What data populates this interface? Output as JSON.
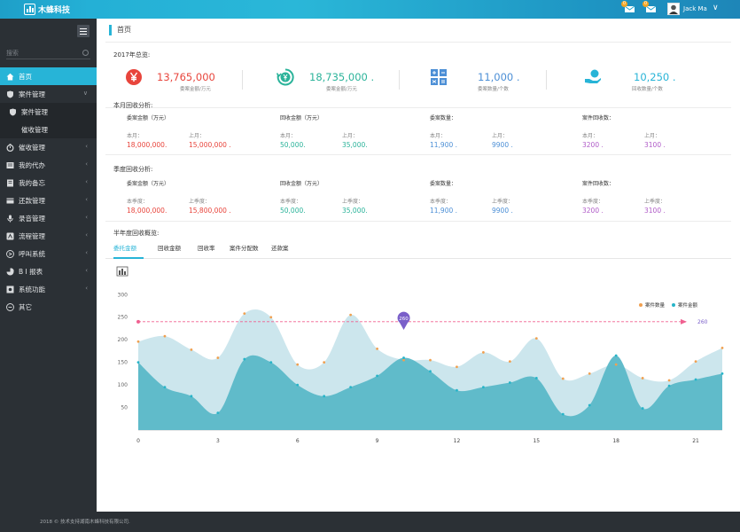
{
  "app": {
    "logo_text": "木蜂科技",
    "page_title": "首页"
  },
  "topbar": {
    "notifications": [
      {
        "icon": "inbox-icon",
        "count": "0"
      },
      {
        "icon": "inbox-download-icon",
        "count": "0"
      }
    ],
    "user_name": "Jack Ma",
    "user_caret": "∨"
  },
  "sidebar": {
    "search_placeholder": "搜索",
    "items": [
      {
        "label": "首页",
        "icon": "home-icon",
        "active": true,
        "sub": false,
        "arrow": ""
      },
      {
        "label": "案件管理",
        "icon": "shield-icon",
        "active": false,
        "sub": false,
        "arrow": "∨"
      },
      {
        "label": "案件管理",
        "icon": "shield-icon",
        "active": false,
        "sub": true,
        "arrow": ""
      },
      {
        "label": "催收管理",
        "icon": "",
        "active": false,
        "sub": true,
        "arrow": ""
      },
      {
        "label": "催收管理",
        "icon": "stopwatch-icon",
        "active": false,
        "sub": false,
        "arrow": "‹"
      },
      {
        "label": "我的代办",
        "icon": "list-icon",
        "active": false,
        "sub": false,
        "arrow": "‹"
      },
      {
        "label": "我的备忘",
        "icon": "book-icon",
        "active": false,
        "sub": false,
        "arrow": "‹"
      },
      {
        "label": "还款管理",
        "icon": "card-icon",
        "active": false,
        "sub": false,
        "arrow": "‹"
      },
      {
        "label": "录音管理",
        "icon": "microphone-icon",
        "active": false,
        "sub": false,
        "arrow": "‹"
      },
      {
        "label": "流程管理",
        "icon": "flow-icon",
        "active": false,
        "sub": false,
        "arrow": "‹"
      },
      {
        "label": "呼叫系统",
        "icon": "phone-icon",
        "active": false,
        "sub": false,
        "arrow": "‹"
      },
      {
        "label": "B I 报表",
        "icon": "pie-icon",
        "active": false,
        "sub": false,
        "arrow": "‹"
      },
      {
        "label": "系统功能",
        "icon": "gear-icon",
        "active": false,
        "sub": false,
        "arrow": "‹"
      },
      {
        "label": "其它",
        "icon": "ellipsis-icon",
        "active": false,
        "sub": false,
        "arrow": ""
      }
    ]
  },
  "overview": {
    "title": "2017年总览:",
    "stats": [
      {
        "value": "13,765,000",
        "caption": "委案金额/万元",
        "icon": "yen-icon",
        "color": "#e8453c"
      },
      {
        "value": "18,735,000 .",
        "caption": "委案金额/万元",
        "icon": "recycle-yen-icon",
        "color": "#2bb39a"
      },
      {
        "value": "11,000 .",
        "caption": "委案数量/个数",
        "icon": "calculator-icon",
        "color": "#4c8fd6"
      },
      {
        "value": "10,250 .",
        "caption": "回收数量/个数",
        "icon": "hand-money-icon",
        "color": "#27b4d7"
      }
    ]
  },
  "monthly": {
    "title": "本月回收分析:",
    "groups": [
      {
        "title": "委案金额（万元）",
        "label_a": "本月：",
        "label_b": "上月：",
        "val_a": "18,000,000.",
        "val_b": "15,000,000 .",
        "color": "#e8453c"
      },
      {
        "title": "回收金额（万元）",
        "label_a": "本月：",
        "label_b": "上月：",
        "val_a": "50,000.",
        "val_b": "35,000.",
        "color": "#2bb39a"
      },
      {
        "title": "委案数量：",
        "label_a": "本月：",
        "label_b": "上月：",
        "val_a": "11,900 .",
        "val_b": "9900 .",
        "color": "#4c8fd6"
      },
      {
        "title": "案件回收数：",
        "label_a": "本月：",
        "label_b": "上月：",
        "val_a": "3200 .",
        "val_b": "3100 .",
        "color": "#b05cc8"
      }
    ]
  },
  "quarterly": {
    "title": "季度回收分析:",
    "groups": [
      {
        "title": "委案金额（万元）",
        "label_a": "本季度：",
        "label_b": "上季度：",
        "val_a": "18,000,000.",
        "val_b": "15,800,000 .",
        "color": "#e8453c"
      },
      {
        "title": "回收金额（万元）",
        "label_a": "本季度：",
        "label_b": "上季度：",
        "val_a": "50,000.",
        "val_b": "35,000.",
        "color": "#2bb39a"
      },
      {
        "title": "委案数量：",
        "label_a": "本季度：",
        "label_b": "上季度：",
        "val_a": "11,900 .",
        "val_b": "9900 .",
        "color": "#4c8fd6"
      },
      {
        "title": "案件回收数：",
        "label_a": "本季度：",
        "label_b": "上季度：",
        "val_a": "3200 .",
        "val_b": "3100 .",
        "color": "#b05cc8"
      }
    ]
  },
  "halfyear": {
    "title": "半年度回收概览:",
    "tabs": [
      "委托金额",
      "回收金额",
      "回收率",
      "案件分配数",
      "还款案"
    ],
    "active_tab": 0
  },
  "chart_data": {
    "type": "area",
    "xlabel": "",
    "ylabel": "",
    "x_ticks": [
      0,
      3,
      6,
      9,
      12,
      15,
      18,
      21
    ],
    "y_ticks": [
      50,
      100,
      150,
      200,
      250,
      300
    ],
    "xlim": [
      0,
      22
    ],
    "ylim": [
      0,
      330
    ],
    "legend_position": "top-right",
    "series": [
      {
        "name": "案件数量",
        "color": "#f0a050",
        "fill": "#b7dce6",
        "x": [
          0,
          1,
          2,
          3,
          4,
          5,
          6,
          7,
          8,
          9,
          10,
          11,
          12,
          13,
          14,
          15,
          16,
          17,
          18,
          19,
          20,
          21,
          22
        ],
        "y": [
          196,
          208,
          178,
          160,
          258,
          250,
          145,
          150,
          255,
          180,
          155,
          155,
          140,
          172,
          152,
          203,
          114,
          125,
          145,
          115,
          110,
          152,
          182
        ]
      },
      {
        "name": "案件金额",
        "color": "#27b4c8",
        "fill": "#5ab8c8",
        "x": [
          0,
          1,
          2,
          3,
          4,
          5,
          6,
          7,
          8,
          9,
          10,
          11,
          12,
          13,
          14,
          15,
          16,
          17,
          18,
          19,
          20,
          21,
          22
        ],
        "y": [
          150,
          95,
          75,
          38,
          157,
          150,
          100,
          75,
          95,
          120,
          160,
          130,
          88,
          95,
          105,
          115,
          35,
          55,
          165,
          48,
          98,
          112,
          125
        ]
      }
    ],
    "markline": {
      "value": 240,
      "label": "260"
    },
    "markpoint": {
      "x": 10,
      "y": 222,
      "label": "260"
    }
  },
  "footer": {
    "copyright": "2018 © 技术支持湖南木蜂科技有限公司."
  }
}
